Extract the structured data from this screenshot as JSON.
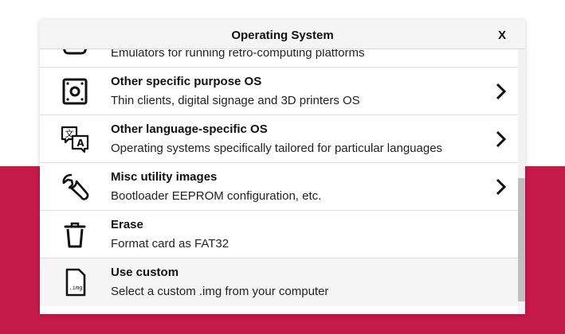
{
  "dialog": {
    "title": "Operating System",
    "close_label": "X"
  },
  "rows": [
    {
      "name": "",
      "description": "Emulators for running retro-computing platforms",
      "icon": "game-controller-icon",
      "has_submenu": true
    },
    {
      "name": "Other specific purpose OS",
      "description": "Thin clients, digital signage and 3D printers OS",
      "icon": "device-icon",
      "has_submenu": true
    },
    {
      "name": "Other language-specific OS",
      "description": "Operating systems specifically tailored for particular languages",
      "icon": "translate-icon",
      "has_submenu": true
    },
    {
      "name": "Misc utility images",
      "description": "Bootloader EEPROM configuration, etc.",
      "icon": "wrench-icon",
      "has_submenu": true
    },
    {
      "name": "Erase",
      "description": "Format card as FAT32",
      "icon": "trash-icon",
      "has_submenu": false
    },
    {
      "name": "Use custom",
      "description": "Select a custom .img from your computer",
      "icon": "img-file-icon",
      "icon_text": ".img",
      "has_submenu": false,
      "selected": true
    }
  ],
  "colors": {
    "background_accent": "#c51a4a",
    "header_bg": "#f5f5f5",
    "selected_row_bg": "#f5f5f5"
  }
}
